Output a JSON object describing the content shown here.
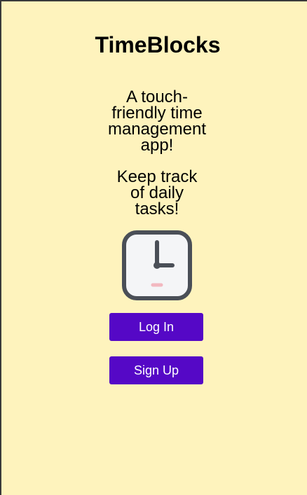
{
  "app": {
    "title": "TimeBlocks"
  },
  "hero": {
    "tagline": "A touch-friendly time management app!",
    "subtagline": "Keep track of daily tasks!",
    "icon": "clock-icon"
  },
  "auth": {
    "login_label": "Log In",
    "signup_label": "Sign Up"
  },
  "colors": {
    "background": "#fef3bd",
    "button": "#5508c6",
    "button_text": "#ffffff",
    "clock_frame": "#4a4f57",
    "clock_face": "#f4f5f7",
    "clock_accent": "#f2b8c0"
  }
}
